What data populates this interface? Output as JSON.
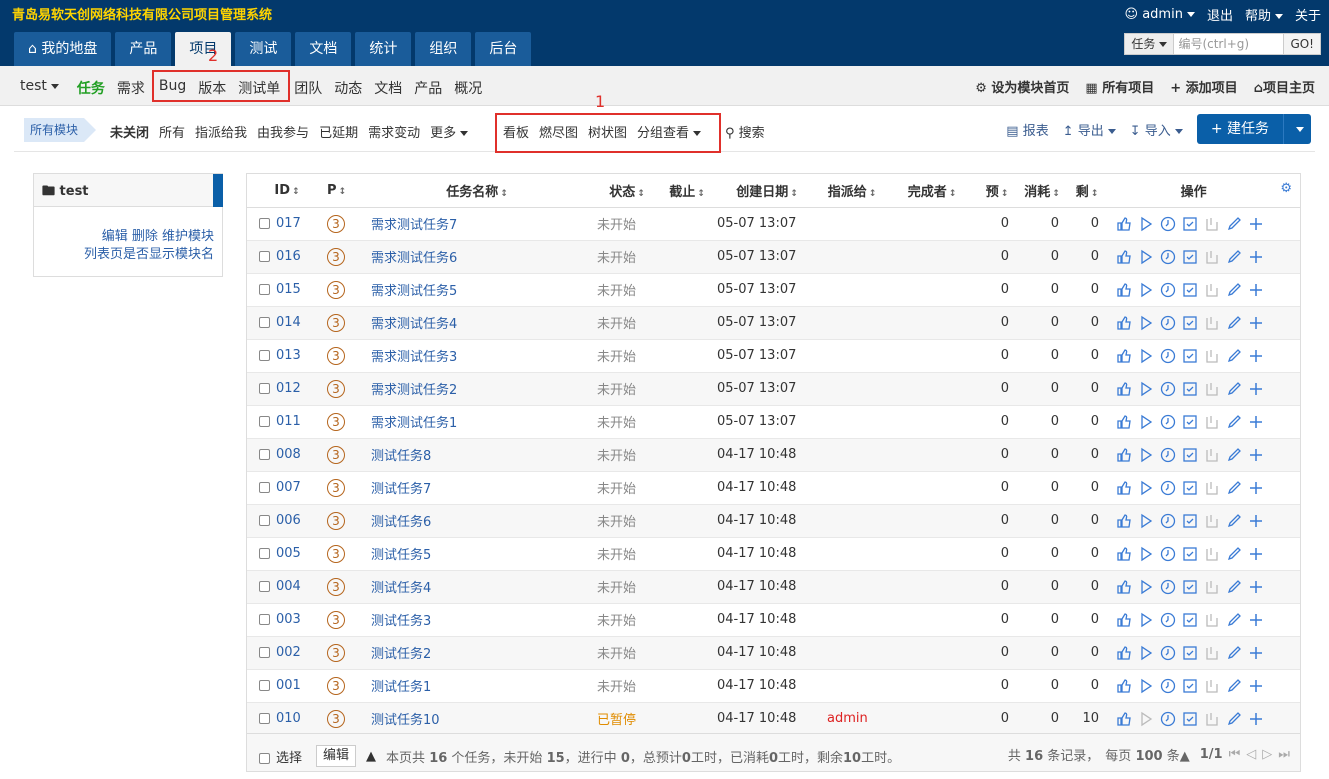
{
  "company": "青岛易软天创网络科技有限公司项目管理系统",
  "user": {
    "name": "admin",
    "logout": "退出",
    "help": "帮助",
    "about": "关于"
  },
  "main_nav": [
    "我的地盘",
    "产品",
    "项目",
    "测试",
    "文档",
    "统计",
    "组织",
    "后台"
  ],
  "active_main_nav": "项目",
  "search": {
    "type": "任务",
    "placeholder": "编号(ctrl+g)",
    "go": "GO!"
  },
  "subnav": {
    "project": "test",
    "items": [
      "任务",
      "需求",
      "Bug",
      "版本",
      "测试单",
      "团队",
      "动态",
      "文档",
      "产品",
      "概况"
    ],
    "active": "任务",
    "right": [
      "设为模块首页",
      "所有项目",
      "添加项目",
      "项目主页"
    ]
  },
  "annotations": {
    "one": "1",
    "two": "2",
    "colors": {
      "box": "#e0302b"
    }
  },
  "featurebar": {
    "all_modules": "所有模块",
    "filters": [
      "未关闭",
      "所有",
      "指派给我",
      "由我参与",
      "已延期",
      "需求变动",
      "更多"
    ],
    "views": [
      "看板",
      "燃尽图",
      "树状图",
      "分组查看"
    ],
    "search": "搜索",
    "report": "报表",
    "export": "导出",
    "import": "导入",
    "create": "建任务"
  },
  "sidebar": {
    "title": "test",
    "links": "编辑 删除 维护模块",
    "toggle": "列表页是否显示模块名"
  },
  "table": {
    "headers": {
      "id": "ID",
      "pri": "P",
      "name": "任务名称",
      "status": "状态",
      "deadline": "截止",
      "opened": "创建日期",
      "assigned": "指派给",
      "finished": "完成者",
      "estimate": "预",
      "consumed": "消耗",
      "left": "剩",
      "actions": "操作"
    },
    "rows": [
      {
        "id": "017",
        "pri": "3",
        "name": "需求测试任务7",
        "status": "未开始",
        "date": "05-07 13:07",
        "assigned": "",
        "est": "0",
        "con": "0",
        "left": "0"
      },
      {
        "id": "016",
        "pri": "3",
        "name": "需求测试任务6",
        "status": "未开始",
        "date": "05-07 13:07",
        "assigned": "",
        "est": "0",
        "con": "0",
        "left": "0"
      },
      {
        "id": "015",
        "pri": "3",
        "name": "需求测试任务5",
        "status": "未开始",
        "date": "05-07 13:07",
        "assigned": "",
        "est": "0",
        "con": "0",
        "left": "0"
      },
      {
        "id": "014",
        "pri": "3",
        "name": "需求测试任务4",
        "status": "未开始",
        "date": "05-07 13:07",
        "assigned": "",
        "est": "0",
        "con": "0",
        "left": "0"
      },
      {
        "id": "013",
        "pri": "3",
        "name": "需求测试任务3",
        "status": "未开始",
        "date": "05-07 13:07",
        "assigned": "",
        "est": "0",
        "con": "0",
        "left": "0"
      },
      {
        "id": "012",
        "pri": "3",
        "name": "需求测试任务2",
        "status": "未开始",
        "date": "05-07 13:07",
        "assigned": "",
        "est": "0",
        "con": "0",
        "left": "0"
      },
      {
        "id": "011",
        "pri": "3",
        "name": "需求测试任务1",
        "status": "未开始",
        "date": "05-07 13:07",
        "assigned": "",
        "est": "0",
        "con": "0",
        "left": "0"
      },
      {
        "id": "008",
        "pri": "3",
        "name": "测试任务8",
        "status": "未开始",
        "date": "04-17 10:48",
        "assigned": "",
        "est": "0",
        "con": "0",
        "left": "0"
      },
      {
        "id": "007",
        "pri": "3",
        "name": "测试任务7",
        "status": "未开始",
        "date": "04-17 10:48",
        "assigned": "",
        "est": "0",
        "con": "0",
        "left": "0"
      },
      {
        "id": "006",
        "pri": "3",
        "name": "测试任务6",
        "status": "未开始",
        "date": "04-17 10:48",
        "assigned": "",
        "est": "0",
        "con": "0",
        "left": "0"
      },
      {
        "id": "005",
        "pri": "3",
        "name": "测试任务5",
        "status": "未开始",
        "date": "04-17 10:48",
        "assigned": "",
        "est": "0",
        "con": "0",
        "left": "0"
      },
      {
        "id": "004",
        "pri": "3",
        "name": "测试任务4",
        "status": "未开始",
        "date": "04-17 10:48",
        "assigned": "",
        "est": "0",
        "con": "0",
        "left": "0"
      },
      {
        "id": "003",
        "pri": "3",
        "name": "测试任务3",
        "status": "未开始",
        "date": "04-17 10:48",
        "assigned": "",
        "est": "0",
        "con": "0",
        "left": "0"
      },
      {
        "id": "002",
        "pri": "3",
        "name": "测试任务2",
        "status": "未开始",
        "date": "04-17 10:48",
        "assigned": "",
        "est": "0",
        "con": "0",
        "left": "0"
      },
      {
        "id": "001",
        "pri": "3",
        "name": "测试任务1",
        "status": "未开始",
        "date": "04-17 10:48",
        "assigned": "",
        "est": "0",
        "con": "0",
        "left": "0"
      },
      {
        "id": "010",
        "pri": "3",
        "name": "测试任务10",
        "status": "已暂停",
        "date": "04-17 10:48",
        "assigned": "admin",
        "est": "0",
        "con": "0",
        "left": "10"
      }
    ]
  },
  "footer": {
    "select_all": "选择",
    "edit": "编辑",
    "summary_prefix": "本页共",
    "summary_total": "16",
    "summary_mid1": "个任务，未开始",
    "summary_wait": "15",
    "summary_mid2": "，进行中",
    "summary_doing": "0",
    "summary_mid3": "，总预计",
    "summary_est": "0",
    "summary_mid4": "工时，已消耗",
    "summary_con": "0",
    "summary_mid5": "工时，剩余",
    "summary_left": "10",
    "summary_end": "工时。",
    "records_prefix": "共",
    "records_count": "16",
    "records_suffix": "条记录，",
    "per_page_prefix": "每页",
    "per_page": "100",
    "per_page_suffix": "条",
    "page": "1/1"
  }
}
